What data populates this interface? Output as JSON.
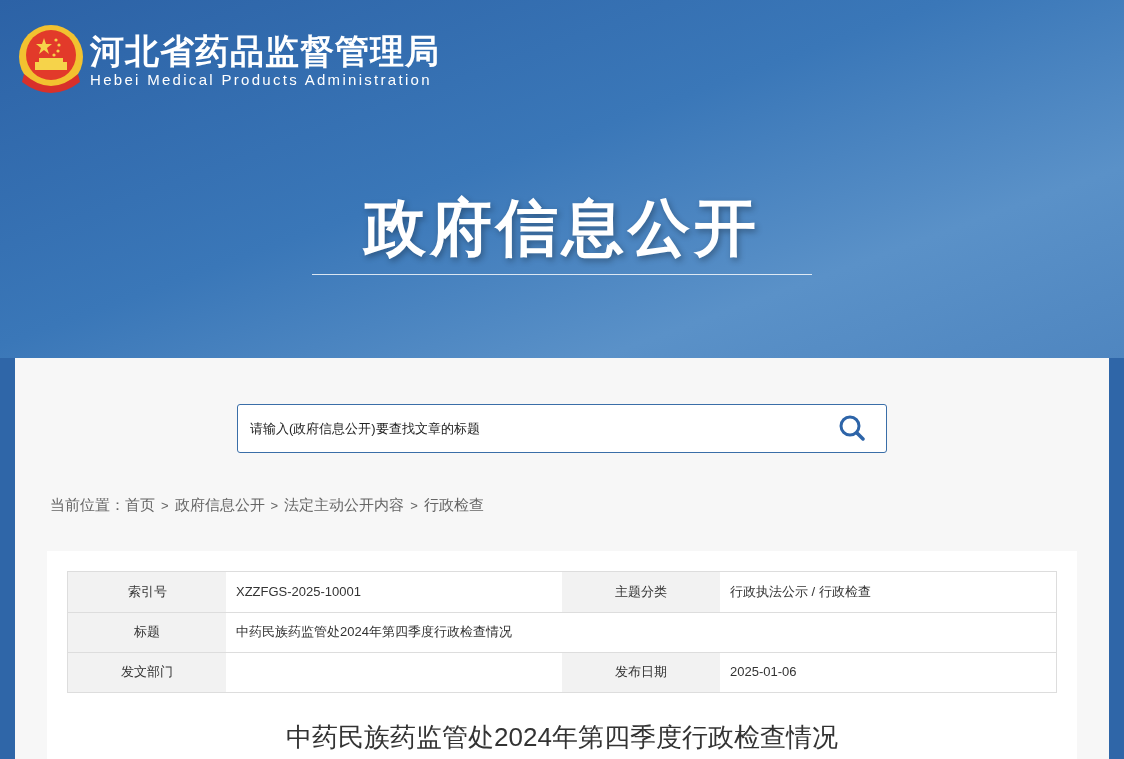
{
  "header": {
    "site_name": "河北省药品监督管理局",
    "site_name_en": "Hebei Medical Products Administration",
    "banner_title": "政府信息公开"
  },
  "search": {
    "placeholder": "请输入(政府信息公开)要查找文章的标题"
  },
  "breadcrumb": [
    {
      "kind": "label",
      "text": "当前位置："
    },
    {
      "kind": "link",
      "text": "首页"
    },
    {
      "kind": "separator",
      "text": ">"
    },
    {
      "kind": "link",
      "text": "政府信息公开"
    },
    {
      "kind": "separator",
      "text": ">"
    },
    {
      "kind": "link",
      "text": "法定主动公开内容"
    },
    {
      "kind": "separator",
      "text": ">"
    },
    {
      "kind": "link",
      "text": "行政检查"
    }
  ],
  "info_table": [
    [
      {
        "label": "索引号",
        "value": "XZZFGS-2025-10001"
      },
      {
        "label": "主题分类",
        "value": "行政执法公示 / 行政检查"
      }
    ],
    [
      {
        "label": "标题",
        "value": "中药民族药监管处2024年第四季度行政检查情况"
      }
    ],
    [
      {
        "label": "发文部门"
      },
      {
        "label": "发布日期",
        "value": "2025-01-06"
      }
    ]
  ],
  "article": {
    "title": "中药民族药监管处2024年第四季度行政检查情况"
  }
}
